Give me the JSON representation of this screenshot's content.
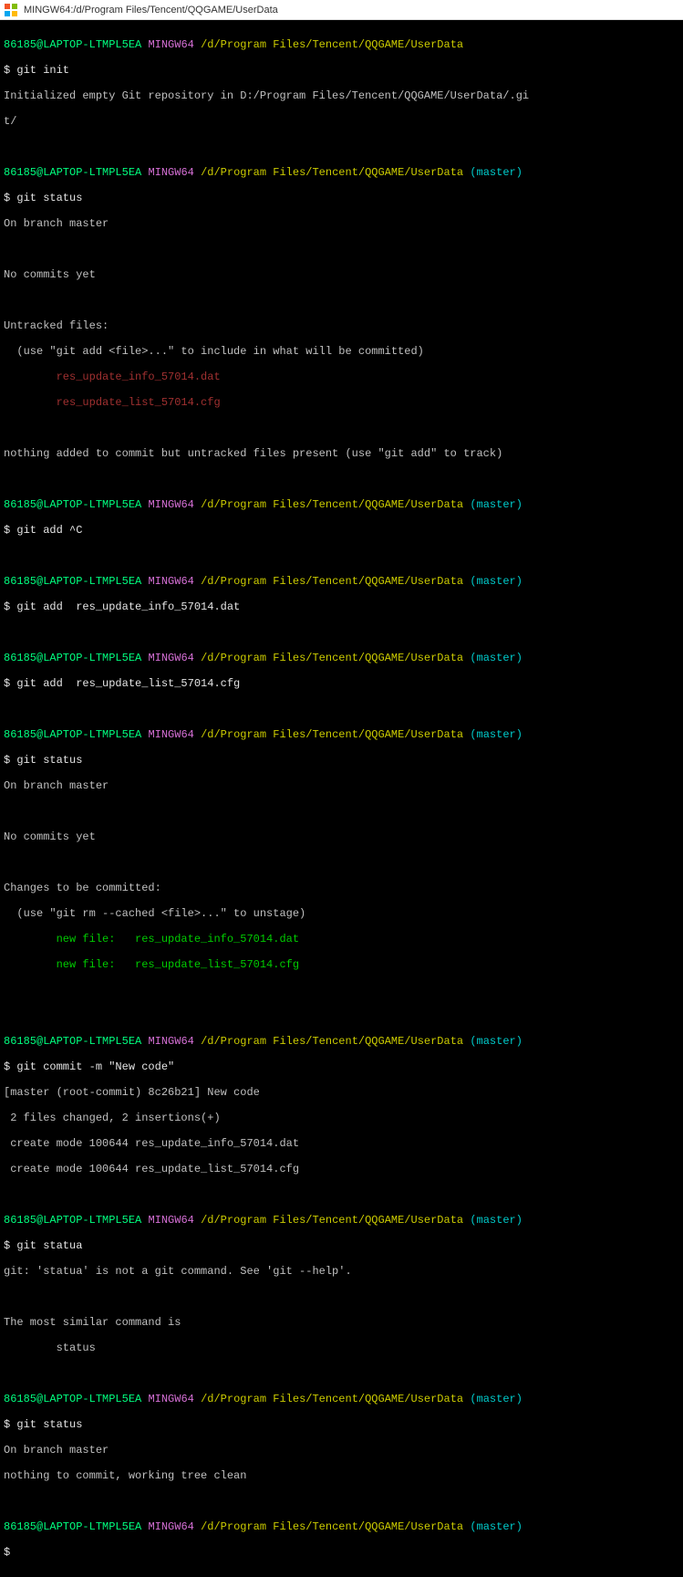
{
  "title": "MINGW64:/d/Program Files/Tencent/QQGAME/UserData",
  "prompt": {
    "user": "86185@LAPTOP-LTMPL5EA",
    "mingw": "MINGW64",
    "path": "/d/Program Files/Tencent/QQGAME/UserData",
    "branch": "(master)",
    "dollar": "$"
  },
  "b": {
    "l1": "$ git init",
    "l2": "Initialized empty Git repository in D:/Program Files/Tencent/QQGAME/UserData/.gi",
    "l3": "t/",
    "l4": "$ git status",
    "l5": "On branch master",
    "l6": "No commits yet",
    "l7": "Untracked files:",
    "l8": "  (use \"git add <file>...\" to include in what will be committed)",
    "l9": "        res_update_info_57014.dat",
    "l10": "        res_update_list_57014.cfg",
    "l11": "nothing added to commit but untracked files present (use \"git add\" to track)",
    "l12": "$ git add ^C",
    "l13": "$ git add  res_update_info_57014.dat",
    "l14": "$ git add  res_update_list_57014.cfg",
    "l15": "$ git status",
    "l16": "On branch master",
    "l17": "No commits yet",
    "l18": "Changes to be committed:",
    "l19": "  (use \"git rm --cached <file>...\" to unstage)",
    "l20": "        new file:   res_update_info_57014.dat",
    "l21": "        new file:   res_update_list_57014.cfg",
    "l22": "$ git commit -m \"New code\"",
    "l23": "[master (root-commit) 8c26b21] New code",
    "l24": " 2 files changed, 2 insertions(+)",
    "l25": " create mode 100644 res_update_info_57014.dat",
    "l26": " create mode 100644 res_update_list_57014.cfg",
    "l27": "$ git statua",
    "l28": "git: 'statua' is not a git command. See 'git --help'.",
    "l29": "The most similar command is",
    "l30": "        status",
    "l31": "$ git status",
    "l32": "On branch master",
    "l33": "nothing to commit, working tree clean",
    "l34": "$"
  }
}
